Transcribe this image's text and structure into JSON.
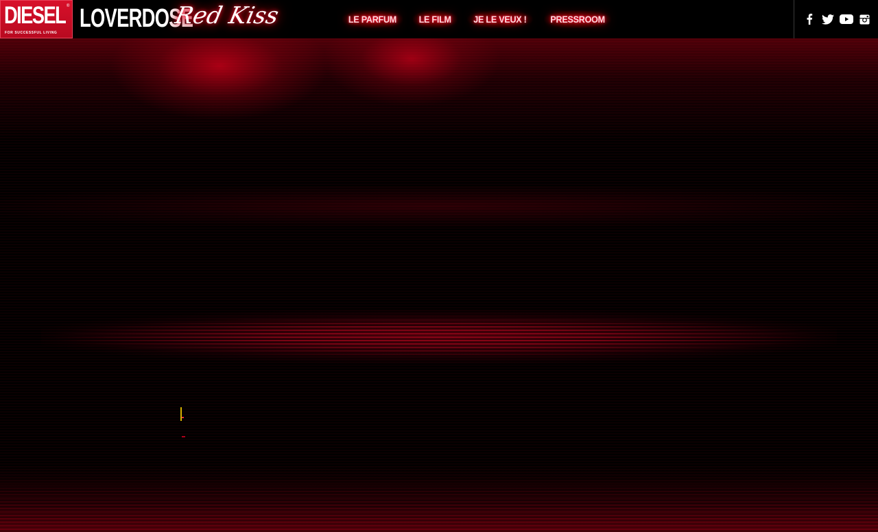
{
  "brand": {
    "name": "DIESEL",
    "tagline": "FOR SUCCESSFUL LIVING",
    "registered": "®",
    "product": "LOVERDOSE",
    "edition": "Red Kiss"
  },
  "nav": {
    "items": [
      {
        "label": "LE PARFUM"
      },
      {
        "label": "LE FILM"
      },
      {
        "label": "JE LE VEUX !"
      },
      {
        "label": "PRESSROOM"
      }
    ]
  },
  "social": {
    "icons": [
      "facebook-icon",
      "twitter-icon",
      "youtube-icon",
      "instagram-icon"
    ]
  },
  "colors": {
    "accent": "#d8102a",
    "glow": "#ff1030",
    "background": "#000000",
    "text": "#ffffff"
  }
}
